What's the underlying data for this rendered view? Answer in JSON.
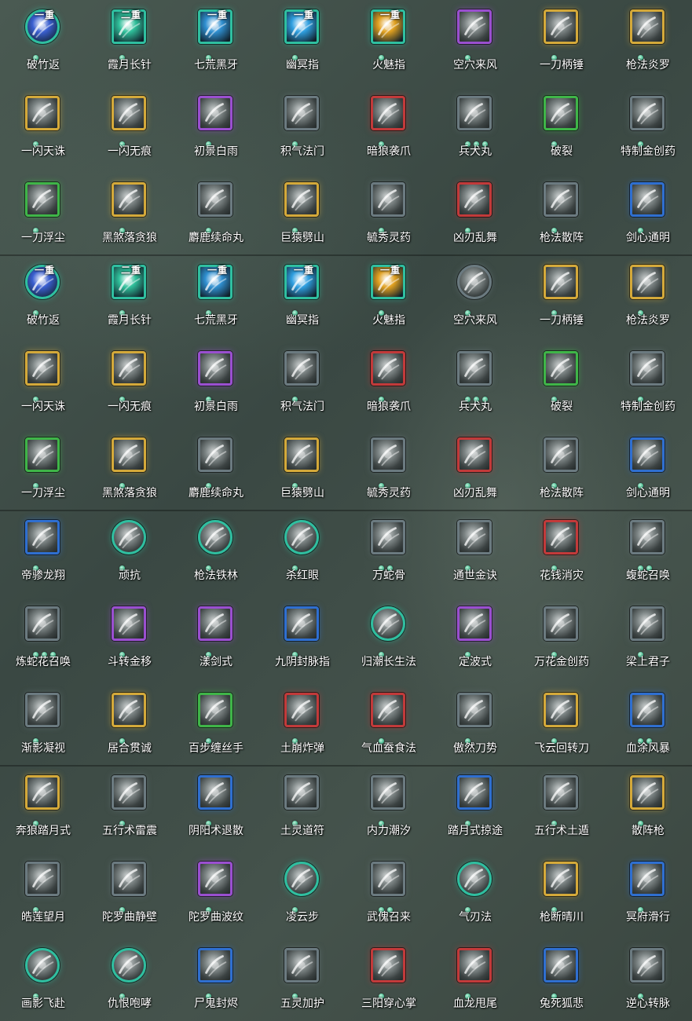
{
  "colors": {
    "gold": "#d4a93a",
    "purple": "#9a4fd0",
    "green": "#3fb548",
    "red": "#c23a3a",
    "blue": "#2f6fd0",
    "teal": "#2fbfa0",
    "gray": "#6b7a80",
    "dot": "#4fbf95"
  },
  "panels": [
    {
      "cells": [
        {
          "name": "破竹返",
          "grade": "一重",
          "frame": "teal",
          "shape": "round",
          "tint": "#3a5fd0",
          "dots": 1
        },
        {
          "name": "霞月长针",
          "grade": "二重",
          "frame": "teal",
          "shape": "square",
          "tint": "#2fbf9a",
          "dots": 1
        },
        {
          "name": "七荒黑牙",
          "grade": "一重",
          "frame": "teal",
          "shape": "square",
          "tint": "#2f8fd0",
          "dots": 1
        },
        {
          "name": "幽冥指",
          "grade": "一重",
          "frame": "teal",
          "shape": "square",
          "tint": "#2f9fe0",
          "dots": 1
        },
        {
          "name": "火魅指",
          "grade": "一重",
          "frame": "teal",
          "shape": "square",
          "tint": "#e0a020",
          "dots": 1
        },
        {
          "name": "空穴来风",
          "grade": "",
          "frame": "purple",
          "shape": "square",
          "tint": "",
          "dots": 1
        },
        {
          "name": "一刀柄锤",
          "grade": "",
          "frame": "gold",
          "shape": "square",
          "tint": "",
          "dots": 1
        },
        {
          "name": "枪法炎罗",
          "grade": "",
          "frame": "gold",
          "shape": "square",
          "tint": "",
          "dots": 1
        },
        {
          "name": "一闪天诛",
          "grade": "",
          "frame": "gold",
          "shape": "square",
          "tint": "",
          "dots": 1
        },
        {
          "name": "一闪无痕",
          "grade": "",
          "frame": "gold",
          "shape": "square",
          "tint": "",
          "dots": 1
        },
        {
          "name": "初景白雨",
          "grade": "",
          "frame": "purple",
          "shape": "square",
          "tint": "",
          "dots": 1
        },
        {
          "name": "积气法门",
          "grade": "",
          "frame": "gray",
          "shape": "square",
          "tint": "",
          "dots": 1
        },
        {
          "name": "暗狼袭爪",
          "grade": "",
          "frame": "red",
          "shape": "square",
          "tint": "",
          "dots": 1
        },
        {
          "name": "兵犬丸",
          "grade": "",
          "frame": "gray",
          "shape": "square",
          "tint": "",
          "dots": 3
        },
        {
          "name": "破裂",
          "grade": "",
          "frame": "green",
          "shape": "square",
          "tint": "",
          "dots": 1
        },
        {
          "name": "特制金创药",
          "grade": "",
          "frame": "gray",
          "shape": "square",
          "tint": "",
          "dots": 1
        },
        {
          "name": "一刀浮尘",
          "grade": "",
          "frame": "green",
          "shape": "square",
          "tint": "",
          "dots": 1
        },
        {
          "name": "黑煞落贪狼",
          "grade": "",
          "frame": "gold",
          "shape": "square",
          "tint": "",
          "dots": 1
        },
        {
          "name": "麝鹿续命丸",
          "grade": "",
          "frame": "gray",
          "shape": "square",
          "tint": "",
          "dots": 1
        },
        {
          "name": "巨猿劈山",
          "grade": "",
          "frame": "gold",
          "shape": "square",
          "tint": "",
          "dots": 1
        },
        {
          "name": "毓秀灵药",
          "grade": "",
          "frame": "gray",
          "shape": "square",
          "tint": "",
          "dots": 1
        },
        {
          "name": "凶刃乱舞",
          "grade": "",
          "frame": "red",
          "shape": "square",
          "tint": "",
          "dots": 1
        },
        {
          "name": "枪法散阵",
          "grade": "",
          "frame": "gray",
          "shape": "square",
          "tint": "",
          "dots": 1
        },
        {
          "name": "剑心通明",
          "grade": "",
          "frame": "blue",
          "shape": "square",
          "tint": "",
          "dots": 1
        }
      ]
    },
    {
      "cells": [
        {
          "name": "破竹返",
          "grade": "一重",
          "frame": "teal",
          "shape": "round",
          "tint": "#3a5fd0",
          "dots": 1
        },
        {
          "name": "霞月长针",
          "grade": "二重",
          "frame": "teal",
          "shape": "square",
          "tint": "#2fbf9a",
          "dots": 1
        },
        {
          "name": "七荒黑牙",
          "grade": "一重",
          "frame": "teal",
          "shape": "square",
          "tint": "#2f8fd0",
          "dots": 1
        },
        {
          "name": "幽冥指",
          "grade": "一重",
          "frame": "teal",
          "shape": "square",
          "tint": "#2f9fe0",
          "dots": 1
        },
        {
          "name": "火魅指",
          "grade": "一重",
          "frame": "teal",
          "shape": "square",
          "tint": "#e0a020",
          "dots": 1
        },
        {
          "name": "空穴来风",
          "grade": "",
          "frame": "gray",
          "shape": "round",
          "tint": "",
          "dots": 1
        },
        {
          "name": "一刀柄锤",
          "grade": "",
          "frame": "gold",
          "shape": "square",
          "tint": "",
          "dots": 1
        },
        {
          "name": "枪法炎罗",
          "grade": "",
          "frame": "gold",
          "shape": "square",
          "tint": "",
          "dots": 1
        },
        {
          "name": "一闪天诛",
          "grade": "",
          "frame": "gold",
          "shape": "square",
          "tint": "",
          "dots": 1
        },
        {
          "name": "一闪无痕",
          "grade": "",
          "frame": "gold",
          "shape": "square",
          "tint": "",
          "dots": 1
        },
        {
          "name": "初景白雨",
          "grade": "",
          "frame": "purple",
          "shape": "square",
          "tint": "",
          "dots": 1
        },
        {
          "name": "积气法门",
          "grade": "",
          "frame": "gray",
          "shape": "square",
          "tint": "",
          "dots": 1
        },
        {
          "name": "暗狼袭爪",
          "grade": "",
          "frame": "red",
          "shape": "square",
          "tint": "",
          "dots": 1
        },
        {
          "name": "兵犬丸",
          "grade": "",
          "frame": "gray",
          "shape": "square",
          "tint": "",
          "dots": 3
        },
        {
          "name": "破裂",
          "grade": "",
          "frame": "green",
          "shape": "square",
          "tint": "",
          "dots": 1
        },
        {
          "name": "特制金创药",
          "grade": "",
          "frame": "gray",
          "shape": "square",
          "tint": "",
          "dots": 1
        },
        {
          "name": "一刀浮尘",
          "grade": "",
          "frame": "green",
          "shape": "square",
          "tint": "",
          "dots": 1
        },
        {
          "name": "黑煞落贪狼",
          "grade": "",
          "frame": "gold",
          "shape": "square",
          "tint": "",
          "dots": 1
        },
        {
          "name": "麝鹿续命丸",
          "grade": "",
          "frame": "gray",
          "shape": "square",
          "tint": "",
          "dots": 1
        },
        {
          "name": "巨猿劈山",
          "grade": "",
          "frame": "gold",
          "shape": "square",
          "tint": "",
          "dots": 1
        },
        {
          "name": "毓秀灵药",
          "grade": "",
          "frame": "gray",
          "shape": "square",
          "tint": "",
          "dots": 1
        },
        {
          "name": "凶刃乱舞",
          "grade": "",
          "frame": "red",
          "shape": "square",
          "tint": "",
          "dots": 1
        },
        {
          "name": "枪法散阵",
          "grade": "",
          "frame": "gray",
          "shape": "square",
          "tint": "",
          "dots": 1
        },
        {
          "name": "剑心通明",
          "grade": "",
          "frame": "blue",
          "shape": "square",
          "tint": "",
          "dots": 1
        }
      ]
    },
    {
      "cells": [
        {
          "name": "帝骖龙翔",
          "grade": "",
          "frame": "blue",
          "shape": "square",
          "tint": "",
          "dots": 1
        },
        {
          "name": "顽抗",
          "grade": "",
          "frame": "teal",
          "shape": "round",
          "tint": "",
          "dots": 1
        },
        {
          "name": "枪法铁林",
          "grade": "",
          "frame": "teal",
          "shape": "round",
          "tint": "",
          "dots": 1
        },
        {
          "name": "杀红眼",
          "grade": "",
          "frame": "teal",
          "shape": "round",
          "tint": "",
          "dots": 1
        },
        {
          "name": "万蛇骨",
          "grade": "",
          "frame": "gray",
          "shape": "square",
          "tint": "",
          "dots": 2
        },
        {
          "name": "通世金诀",
          "grade": "",
          "frame": "gray",
          "shape": "square",
          "tint": "",
          "dots": 1
        },
        {
          "name": "花钱消灾",
          "grade": "",
          "frame": "red",
          "shape": "square",
          "tint": "",
          "dots": 1
        },
        {
          "name": "蝮蛇召唤",
          "grade": "",
          "frame": "gray",
          "shape": "square",
          "tint": "",
          "dots": 2
        },
        {
          "name": "炼蛇花召唤",
          "grade": "",
          "frame": "gray",
          "shape": "square",
          "tint": "",
          "dots": 3
        },
        {
          "name": "斗转金移",
          "grade": "",
          "frame": "purple",
          "shape": "square",
          "tint": "",
          "dots": 1
        },
        {
          "name": "漾剑式",
          "grade": "",
          "frame": "purple",
          "shape": "square",
          "tint": "",
          "dots": 1
        },
        {
          "name": "九阴封脉指",
          "grade": "",
          "frame": "blue",
          "shape": "square",
          "tint": "",
          "dots": 1
        },
        {
          "name": "归潮长生法",
          "grade": "",
          "frame": "teal",
          "shape": "round",
          "tint": "",
          "dots": 1
        },
        {
          "name": "定波式",
          "grade": "",
          "frame": "purple",
          "shape": "square",
          "tint": "",
          "dots": 1
        },
        {
          "name": "万花金创药",
          "grade": "",
          "frame": "gray",
          "shape": "square",
          "tint": "",
          "dots": 1
        },
        {
          "name": "梁上君子",
          "grade": "",
          "frame": "gray",
          "shape": "square",
          "tint": "",
          "dots": 1
        },
        {
          "name": "渐影凝视",
          "grade": "",
          "frame": "gray",
          "shape": "square",
          "tint": "",
          "dots": 1
        },
        {
          "name": "居合贯诚",
          "grade": "",
          "frame": "gold",
          "shape": "square",
          "tint": "",
          "dots": 1
        },
        {
          "name": "百步缠丝手",
          "grade": "",
          "frame": "green",
          "shape": "square",
          "tint": "",
          "dots": 1
        },
        {
          "name": "土崩炸弹",
          "grade": "",
          "frame": "red",
          "shape": "square",
          "tint": "",
          "dots": 1
        },
        {
          "name": "气血蚕食法",
          "grade": "",
          "frame": "red",
          "shape": "square",
          "tint": "",
          "dots": 1
        },
        {
          "name": "傲然刀势",
          "grade": "",
          "frame": "gray",
          "shape": "square",
          "tint": "",
          "dots": 1
        },
        {
          "name": "飞云回转刀",
          "grade": "",
          "frame": "gold",
          "shape": "square",
          "tint": "",
          "dots": 1
        },
        {
          "name": "血涂风暴",
          "grade": "",
          "frame": "blue",
          "shape": "square",
          "tint": "",
          "dots": 2
        }
      ]
    },
    {
      "cells": [
        {
          "name": "奔狼踏月式",
          "grade": "",
          "frame": "gold",
          "shape": "square",
          "tint": "",
          "dots": 1
        },
        {
          "name": "五行术雷震",
          "grade": "",
          "frame": "gray",
          "shape": "square",
          "tint": "",
          "dots": 1
        },
        {
          "name": "阴阳术退散",
          "grade": "",
          "frame": "blue",
          "shape": "square",
          "tint": "",
          "dots": 1
        },
        {
          "name": "土灵道符",
          "grade": "",
          "frame": "gray",
          "shape": "square",
          "tint": "",
          "dots": 1
        },
        {
          "name": "内力潮汐",
          "grade": "",
          "frame": "gray",
          "shape": "square",
          "tint": "",
          "dots": 1
        },
        {
          "name": "踏月式掠途",
          "grade": "",
          "frame": "blue",
          "shape": "square",
          "tint": "",
          "dots": 1
        },
        {
          "name": "五行术土遁",
          "grade": "",
          "frame": "gray",
          "shape": "square",
          "tint": "",
          "dots": 1
        },
        {
          "name": "散阵枪",
          "grade": "",
          "frame": "gold",
          "shape": "square",
          "tint": "",
          "dots": 1
        },
        {
          "name": "皓莲望月",
          "grade": "",
          "frame": "gray",
          "shape": "square",
          "tint": "",
          "dots": 1
        },
        {
          "name": "陀罗曲静壁",
          "grade": "",
          "frame": "gray",
          "shape": "square",
          "tint": "",
          "dots": 1
        },
        {
          "name": "陀罗曲波纹",
          "grade": "",
          "frame": "purple",
          "shape": "square",
          "tint": "",
          "dots": 1
        },
        {
          "name": "凌云步",
          "grade": "",
          "frame": "teal",
          "shape": "round",
          "tint": "",
          "dots": 1
        },
        {
          "name": "武傀召来",
          "grade": "",
          "frame": "gray",
          "shape": "square",
          "tint": "",
          "dots": 2
        },
        {
          "name": "气刃法",
          "grade": "",
          "frame": "teal",
          "shape": "round",
          "tint": "",
          "dots": 1
        },
        {
          "name": "枪断晴川",
          "grade": "",
          "frame": "gold",
          "shape": "square",
          "tint": "",
          "dots": 1
        },
        {
          "name": "冥府滑行",
          "grade": "",
          "frame": "blue",
          "shape": "square",
          "tint": "",
          "dots": 1
        },
        {
          "name": "画影飞赴",
          "grade": "",
          "frame": "teal",
          "shape": "round",
          "tint": "",
          "dots": 1
        },
        {
          "name": "仇恨咆哮",
          "grade": "",
          "frame": "teal",
          "shape": "round",
          "tint": "",
          "dots": 1
        },
        {
          "name": "尸鬼封烬",
          "grade": "",
          "frame": "blue",
          "shape": "square",
          "tint": "",
          "dots": 1
        },
        {
          "name": "五灵加护",
          "grade": "",
          "frame": "gray",
          "shape": "square",
          "tint": "",
          "dots": 1
        },
        {
          "name": "三阳穿心掌",
          "grade": "",
          "frame": "red",
          "shape": "square",
          "tint": "",
          "dots": 1
        },
        {
          "name": "血龙甩尾",
          "grade": "",
          "frame": "red",
          "shape": "square",
          "tint": "",
          "dots": 1
        },
        {
          "name": "兔死狐悲",
          "grade": "",
          "frame": "blue",
          "shape": "square",
          "tint": "",
          "dots": 1
        },
        {
          "name": "逆心转脉",
          "grade": "",
          "frame": "gray",
          "shape": "square",
          "tint": "",
          "dots": 1
        }
      ]
    }
  ]
}
